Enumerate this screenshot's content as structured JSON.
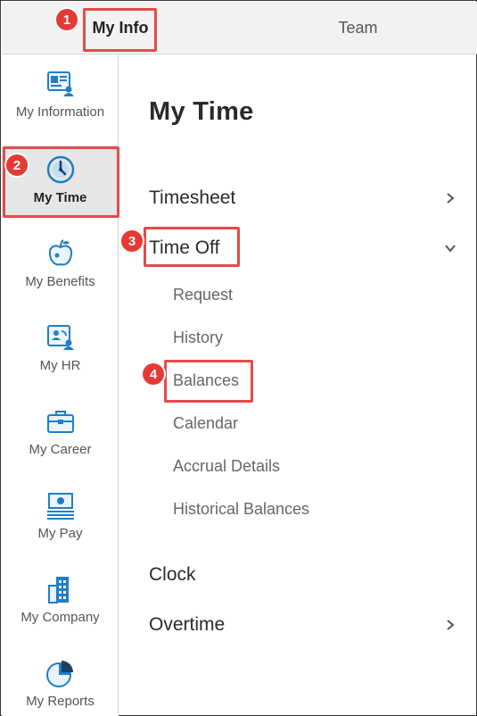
{
  "tabs": [
    {
      "label": "My Info"
    },
    {
      "label": "Team"
    }
  ],
  "sidebar": {
    "items": [
      {
        "label": "My Information",
        "icon": "id-card-icon"
      },
      {
        "label": "My Time",
        "icon": "clock-icon"
      },
      {
        "label": "My Benefits",
        "icon": "apple-icon"
      },
      {
        "label": "My HR",
        "icon": "hr-profile-icon"
      },
      {
        "label": "My Career",
        "icon": "briefcase-icon"
      },
      {
        "label": "My Pay",
        "icon": "pay-stub-icon"
      },
      {
        "label": "My Company",
        "icon": "building-icon"
      },
      {
        "label": "My Reports",
        "icon": "pie-chart-icon"
      }
    ]
  },
  "main": {
    "title": "My Time",
    "nav": {
      "timesheet": "Timesheet",
      "time_off": "Time Off",
      "clock": "Clock",
      "overtime": "Overtime"
    },
    "time_off_items": [
      "Request",
      "History",
      "Balances",
      "Calendar",
      "Accrual Details",
      "Historical Balances"
    ]
  },
  "annotations": [
    "1",
    "2",
    "3",
    "4"
  ],
  "colors": {
    "accent_blue": "#1f7ec7",
    "highlight_red": "#e24b4b",
    "marker_red": "#e53935",
    "active_bg": "#e6e6e6"
  }
}
